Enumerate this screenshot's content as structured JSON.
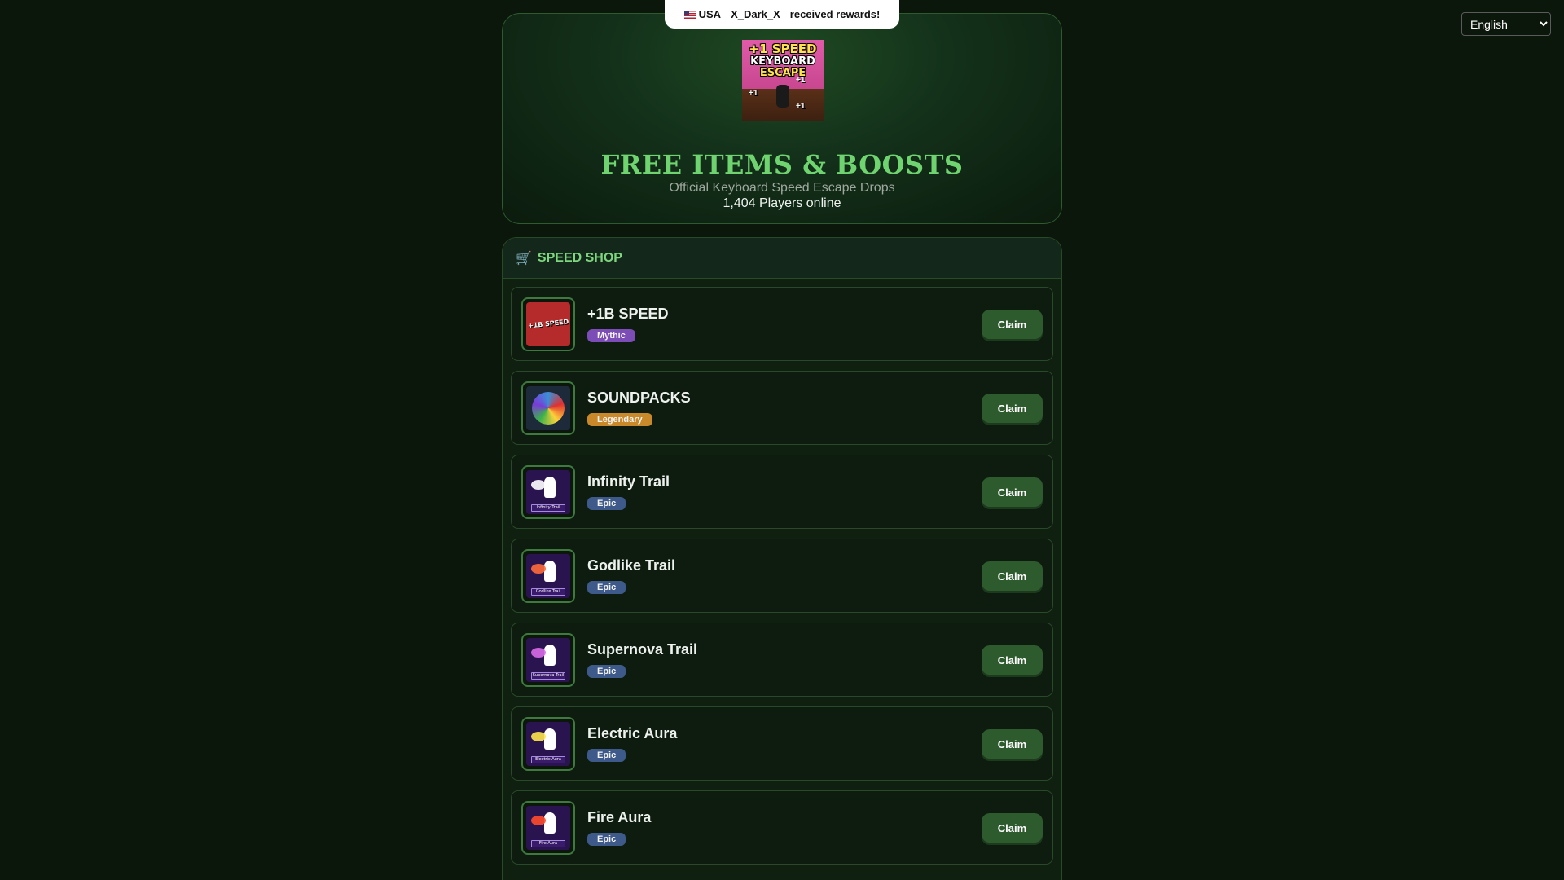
{
  "toast": {
    "country": "USA",
    "username": "X_Dark_X",
    "message": "received rewards!"
  },
  "language": {
    "selected": "English",
    "options": [
      "English"
    ]
  },
  "hero": {
    "title": "FREE ITEMS & BOOSTS",
    "subtitle": "Official Keyboard Speed Escape Drops",
    "online": "1,404 Players online",
    "art_line1": "+1 SPEED",
    "art_line2": "KEYBOARD",
    "art_line3": "ESCAPE",
    "art_plus": "+1"
  },
  "shop": {
    "icon": "cart-icon",
    "title": "SPEED SHOP",
    "claim_label": "Claim",
    "items": [
      {
        "name": "+1B SPEED",
        "rarity": "Mythic",
        "rarity_color": "#7c4db6",
        "thumb_text": "+1B SPEED",
        "thumb_bg": "#b52a2a"
      },
      {
        "name": "SOUNDPACKS",
        "rarity": "Legendary",
        "rarity_color": "#c9892a",
        "thumb_text": "",
        "thumb_bg": "#1d2a3a"
      },
      {
        "name": "Infinity Trail",
        "rarity": "Epic",
        "rarity_color": "#3d5a8a",
        "thumb_text": "Infinity Trail",
        "thumb_bg": "#2a1450"
      },
      {
        "name": "Godlike Trail",
        "rarity": "Epic",
        "rarity_color": "#3d5a8a",
        "thumb_text": "Godlike Trail",
        "thumb_bg": "#2a1450"
      },
      {
        "name": "Supernova Trail",
        "rarity": "Epic",
        "rarity_color": "#3d5a8a",
        "thumb_text": "Supernova Trail",
        "thumb_bg": "#2a1450"
      },
      {
        "name": "Electric Aura",
        "rarity": "Epic",
        "rarity_color": "#3d5a8a",
        "thumb_text": "Electric Aura",
        "thumb_bg": "#2a1450"
      },
      {
        "name": "Fire Aura",
        "rarity": "Epic",
        "rarity_color": "#3d5a8a",
        "thumb_text": "Fire Aura",
        "thumb_bg": "#2a1450"
      }
    ]
  }
}
